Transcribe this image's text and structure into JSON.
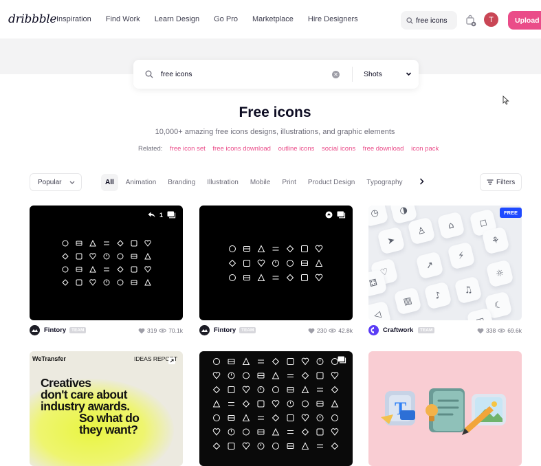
{
  "header": {
    "logo": "dribbble",
    "nav": [
      "Inspiration",
      "Find Work",
      "Learn Design",
      "Go Pro",
      "Marketplace",
      "Hire Designers"
    ],
    "search_value": "free icons",
    "avatar_letter": "T",
    "upload_label": "Upload"
  },
  "search": {
    "value": "free icons",
    "type_select": "Shots"
  },
  "hero": {
    "title": "Free icons",
    "subtitle": "10,000+ amazing free icons designs, illustrations, and graphic elements",
    "related_label": "Related:",
    "related": [
      "free icon set",
      "free icons download",
      "outline icons",
      "social icons",
      "free download",
      "icon pack"
    ]
  },
  "filters": {
    "sort": "Popular",
    "categories": [
      "All",
      "Animation",
      "Branding",
      "Illustration",
      "Mobile",
      "Print",
      "Product Design",
      "Typography"
    ],
    "filters_label": "Filters"
  },
  "shots": [
    {
      "author": "Fintory",
      "team": "TEAM",
      "likes": "319",
      "views": "70.1k",
      "attachments": "1"
    },
    {
      "author": "Fintory",
      "team": "TEAM",
      "likes": "230",
      "views": "42.8k"
    },
    {
      "author": "Craftwork",
      "team": "TEAM",
      "likes": "338",
      "views": "69.6k",
      "badge": "FREE"
    },
    {
      "wt_logo": "WeTransfer",
      "wt_ideas": "IDEAS REPORT",
      "wt_lines": [
        "Creatives",
        "don't care about",
        "industry awards.",
        "So what do",
        "they want?"
      ]
    },
    {},
    {}
  ],
  "colors": {
    "accent": "#ea4c89",
    "free_badge": "#1f4aff"
  }
}
